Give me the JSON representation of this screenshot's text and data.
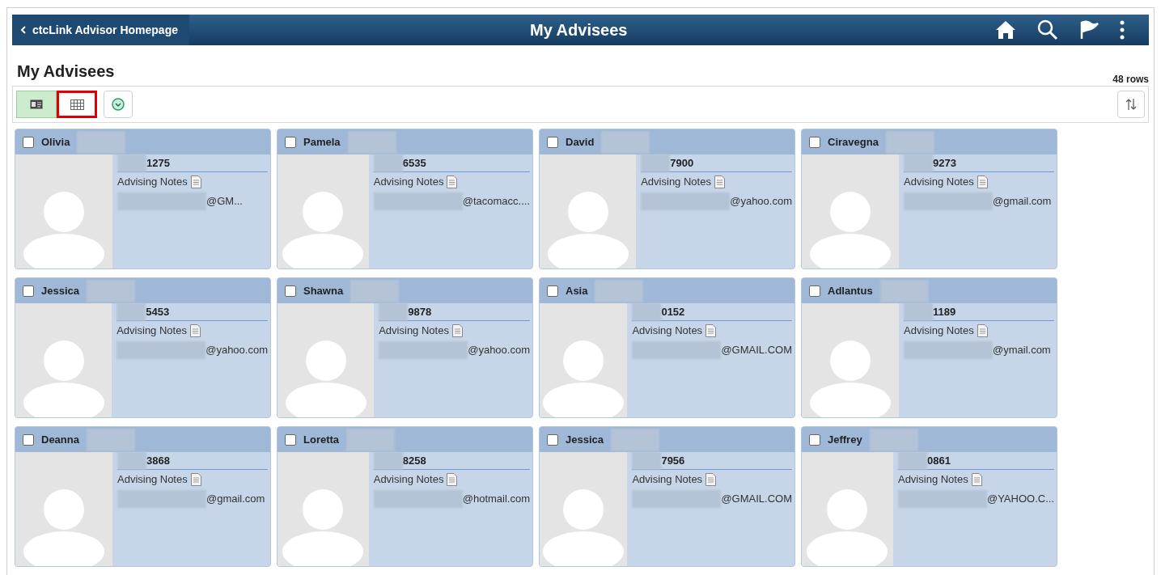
{
  "header": {
    "back_label": "ctcLink Advisor Homepage",
    "title": "My Advisees"
  },
  "page_title": "My Advisees",
  "row_count": "48 rows",
  "view_buttons": [
    {
      "kind": "card",
      "selected": true,
      "highlighted": false
    },
    {
      "kind": "grid",
      "selected": false,
      "highlighted": true
    }
  ],
  "advisees": [
    {
      "name": "Olivia",
      "id": "1275",
      "notes_label": "Advising Notes",
      "email": "@GM...",
      "checked": false
    },
    {
      "name": "Pamela",
      "id": "6535",
      "notes_label": "Advising Notes",
      "email": "@tacomacc....",
      "checked": false
    },
    {
      "name": "David",
      "id": "7900",
      "notes_label": "Advising Notes",
      "email": "@yahoo.com",
      "checked": false
    },
    {
      "name": "Ciravegna",
      "id": "9273",
      "notes_label": "Advising Notes",
      "email": "@gmail.com",
      "checked": false
    },
    {
      "name": "Jessica",
      "id": "5453",
      "notes_label": "Advising Notes",
      "email": "@yahoo.com",
      "checked": false
    },
    {
      "name": "Shawna",
      "id": "9878",
      "notes_label": "Advising Notes",
      "email": "@yahoo.com",
      "checked": false
    },
    {
      "name": "Asia",
      "id": "0152",
      "notes_label": "Advising Notes",
      "email": "@GMAIL.COM",
      "checked": false
    },
    {
      "name": "Adlantus",
      "id": "1189",
      "notes_label": "Advising Notes",
      "email": "@ymail.com",
      "checked": false
    },
    {
      "name": "Deanna",
      "id": "3868",
      "notes_label": "Advising Notes",
      "email": "@gmail.com",
      "checked": false
    },
    {
      "name": "Loretta",
      "id": "8258",
      "notes_label": "Advising Notes",
      "email": "@hotmail.com",
      "checked": false
    },
    {
      "name": "Jessica",
      "id": "7956",
      "notes_label": "Advising Notes",
      "email": "@GMAIL.COM",
      "checked": false
    },
    {
      "name": "Jeffrey",
      "id": "0861",
      "notes_label": "Advising Notes",
      "email": "@YAHOO.C...",
      "checked": false
    }
  ]
}
